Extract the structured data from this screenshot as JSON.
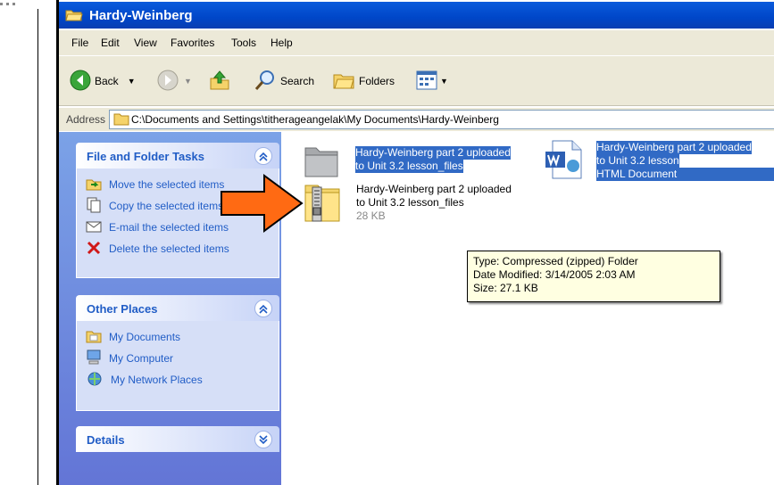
{
  "window": {
    "title": "Hardy-Weinberg"
  },
  "menu": [
    "File",
    "Edit",
    "View",
    "Favorites",
    "Tools",
    "Help"
  ],
  "toolbar": {
    "back": "Back",
    "search": "Search",
    "folders": "Folders"
  },
  "address": {
    "label": "Address",
    "path": "C:\\Documents and Settings\\titherageangelak\\My Documents\\Hardy-Weinberg"
  },
  "panels": {
    "file_tasks": {
      "title": "File and Folder Tasks",
      "items": [
        "Move the selected items",
        "Copy the selected items",
        "E-mail the selected items",
        "Delete the selected items"
      ]
    },
    "other_places": {
      "title": "Other Places",
      "items": [
        "My Documents",
        "My Computer",
        "My Network Places"
      ]
    },
    "details": {
      "title": "Details"
    }
  },
  "files": {
    "folder": {
      "line1": "Hardy-Weinberg part 2 uploaded",
      "line2": "to Unit 3.2 lesson_files"
    },
    "html_doc": {
      "line1": "Hardy-Weinberg part 2 uploaded",
      "line2": "to Unit 3.2 lesson",
      "line3": "HTML Document"
    },
    "zip": {
      "line1": "Hardy-Weinberg part 2 uploaded",
      "line2": "to Unit 3.2 lesson_files",
      "size": "28 KB"
    }
  },
  "tooltip": {
    "type": "Type: Compressed (zipped) Folder",
    "modified": "Date Modified: 3/14/2005 2:03 AM",
    "size": "Size: 27.1 KB"
  },
  "colors": {
    "title_bar": "#0054e3",
    "selection": "#316ac5",
    "task_pane": "#6f8ee0",
    "link": "#215dc6",
    "arrow": "#ff6a13"
  }
}
